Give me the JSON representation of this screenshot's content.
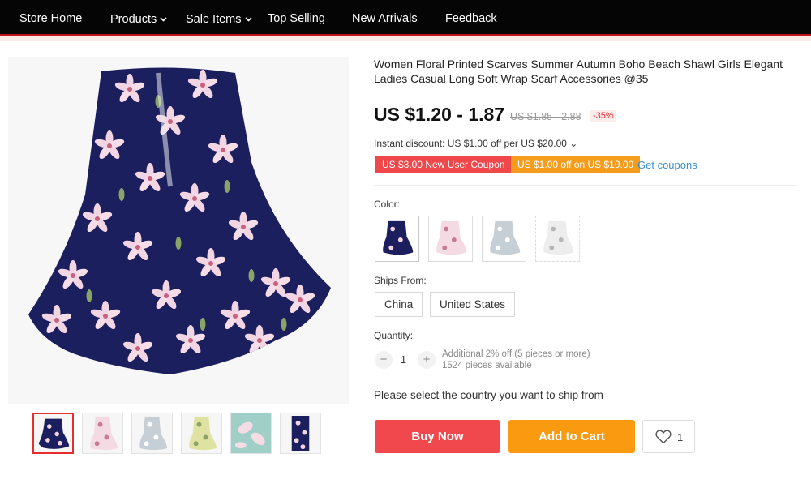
{
  "nav": {
    "items": [
      {
        "label": "Store Home"
      },
      {
        "label": "Products",
        "dropdown": true
      },
      {
        "label": "Sale Items",
        "dropdown": true
      },
      {
        "label": "Top Selling"
      },
      {
        "label": "New Arrivals"
      },
      {
        "label": "Feedback"
      }
    ],
    "chevron_glyph": "⌄"
  },
  "product": {
    "title": "Women Floral Printed Scarves Summer Autumn Boho Beach Shawl Girls Elegant Ladies Casual Long Soft Wrap Scarf Accessories @35",
    "price": "US $1.20 - 1.87",
    "original_price": "US $1.85 - 2.88",
    "discount": "-35%",
    "instant_discount": "Instant discount: US $1.00 off per US $20.00 ⌄",
    "coupons": [
      "US $3.00 New User Coupon",
      "US $1.00 off on US $19.00"
    ],
    "get_coupons": "Get coupons",
    "color_label": "Color:",
    "colors": [
      "navy-floral",
      "pink-floral",
      "grey-floral",
      "white-floral"
    ],
    "ships_from_label": "Ships From:",
    "ships_from": [
      "China",
      "United States"
    ],
    "quantity_label": "Quantity:",
    "quantity": "1",
    "qty_minus": "−",
    "qty_plus": "+",
    "qty_note_1": "Additional 2% off (5 pieces or more)",
    "qty_note_2": "1524 pieces available",
    "ship_message": "Please select the country you want to ship from",
    "buy_now": "Buy Now",
    "add_to_cart": "Add to Cart",
    "wishlist_count": "1"
  },
  "gallery": {
    "thumbnails": [
      "navy-floral",
      "pink-floral",
      "grey-floral",
      "yellow-floral",
      "teal-closeup",
      "navy-floral-alt"
    ],
    "selected_index": 0
  },
  "colors": {
    "nav_bg": "#050505",
    "accent_red": "#f0484c",
    "accent_orange": "#fa9a11",
    "link_blue": "#3d8fce",
    "scarf_navy": "#1c1f5e"
  },
  "icons": {
    "wishlist": "heart-icon"
  }
}
